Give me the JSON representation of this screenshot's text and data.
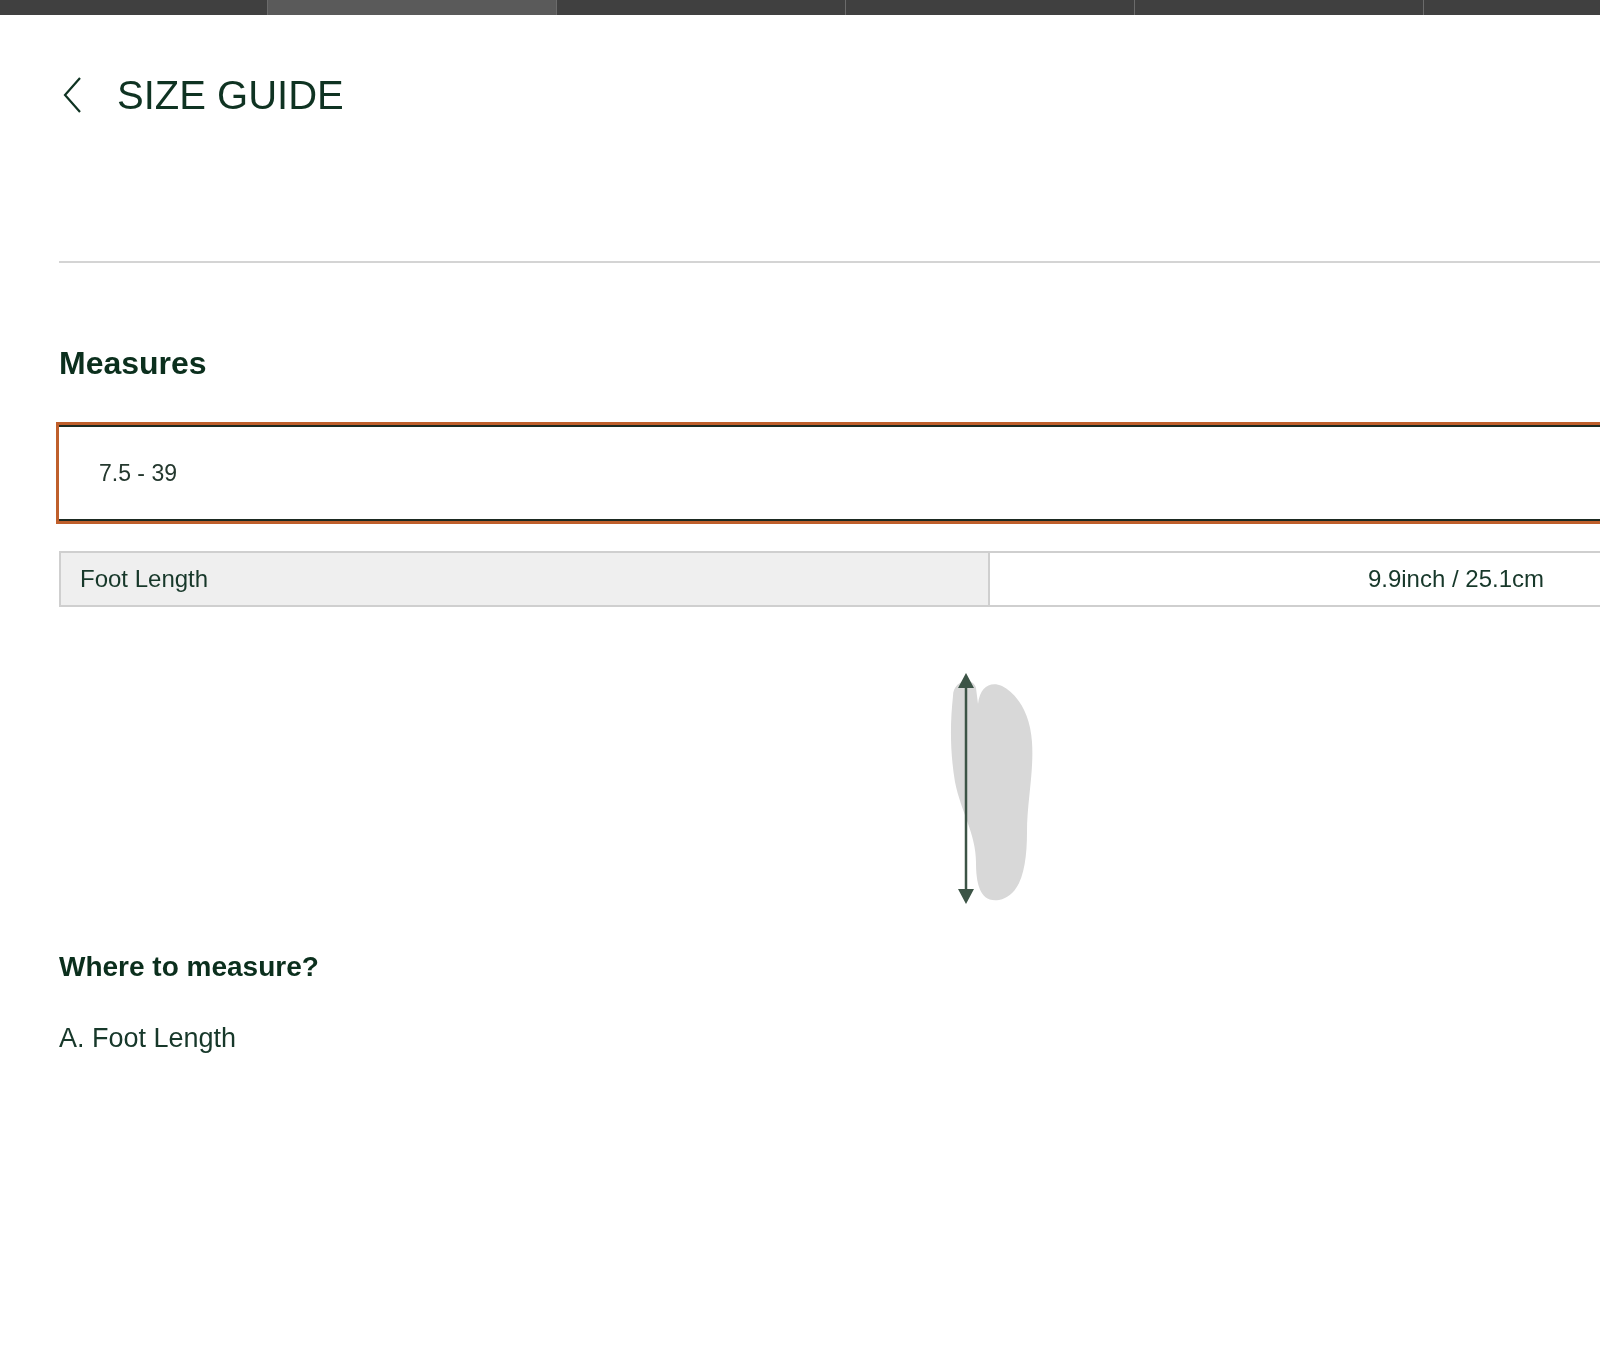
{
  "tab_strip": [
    {
      "selected": false
    },
    {
      "selected": true
    },
    {
      "selected": false
    },
    {
      "selected": false
    },
    {
      "selected": false
    },
    {
      "selected": false
    }
  ],
  "header": {
    "title": "SIZE GUIDE"
  },
  "measures": {
    "heading": "Measures",
    "size_select": {
      "value": "7.5 - 39",
      "focused": true
    },
    "rows": [
      {
        "label": "Foot Length",
        "value": "9.9inch / 25.1cm"
      }
    ]
  },
  "where_to_measure": {
    "heading": "Where to measure?",
    "items": [
      "A. Foot Length"
    ]
  }
}
